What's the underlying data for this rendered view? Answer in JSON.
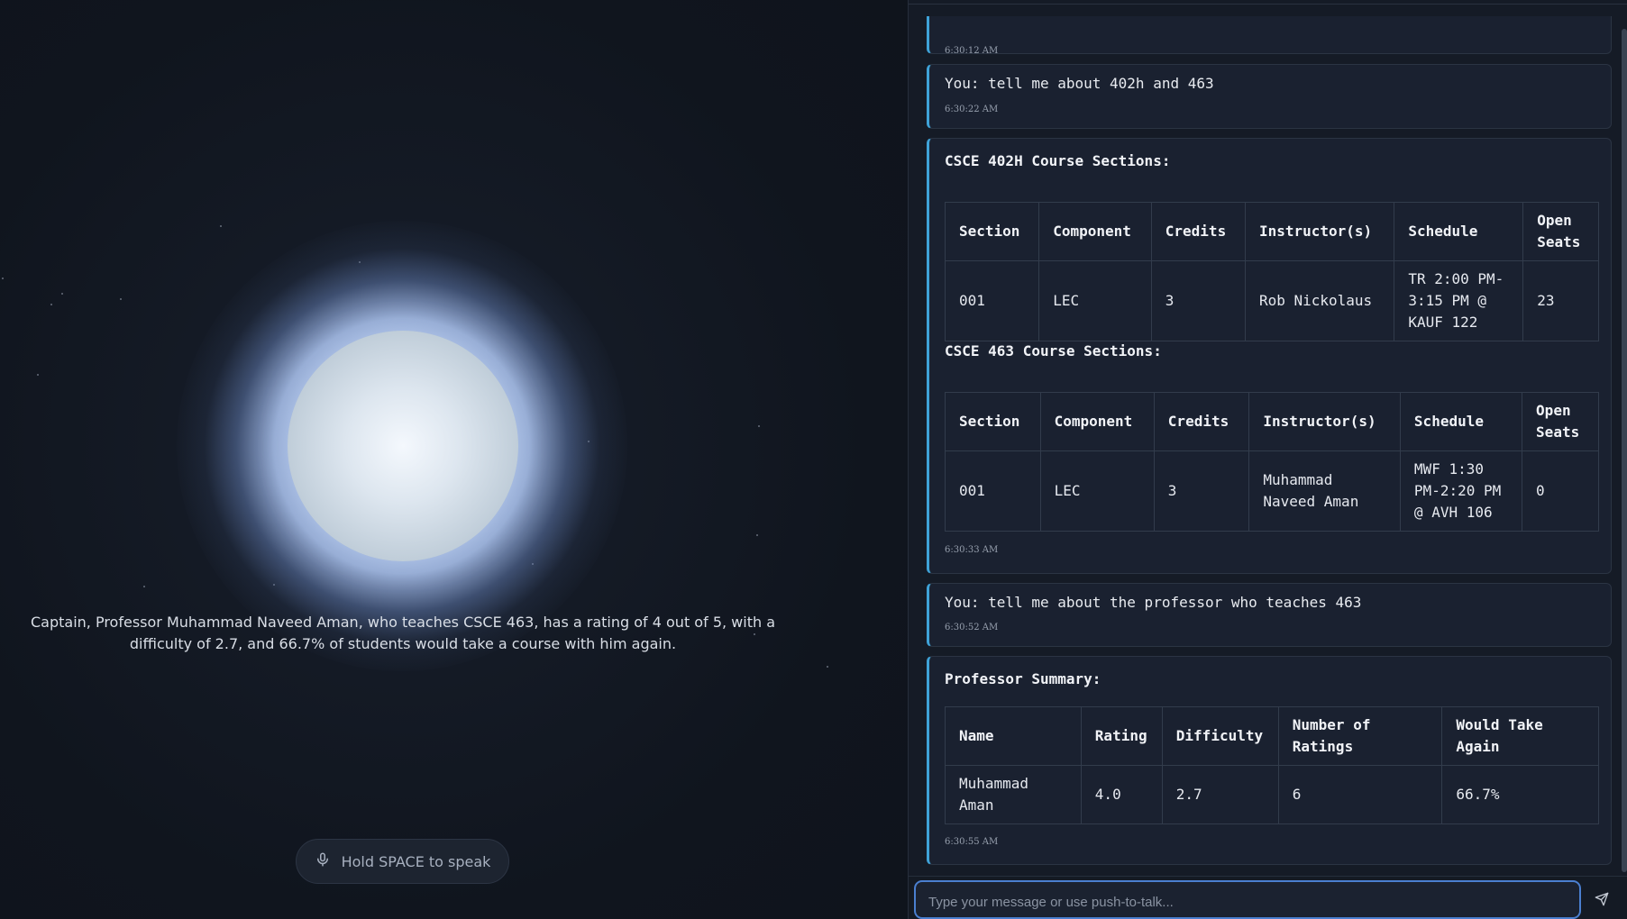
{
  "assistant": {
    "caption": "Captain, Professor Muhammad Naveed Aman, who teaches CSCE 463, has a rating of 4 out of 5, with a difficulty of 2.7, and 66.7% of students would take a course with him again.",
    "push_to_talk_label": "Hold SPACE to speak",
    "mic_icon": "microphone-icon"
  },
  "chat": {
    "messages": [
      {
        "type": "partial",
        "timestamp": "6:30:12 AM"
      },
      {
        "type": "user",
        "text": "You: tell me about 402h and 463",
        "timestamp": "6:30:22 AM"
      },
      {
        "type": "assistant",
        "timestamp": "6:30:33 AM",
        "sections": [
          {
            "heading": "CSCE 402H Course Sections:",
            "columns": [
              "Section",
              "Component",
              "Credits",
              "Instructor(s)",
              "Schedule",
              "Open Seats"
            ],
            "rows": [
              [
                "001",
                "LEC",
                "3",
                "Rob Nickolaus",
                "TR 2:00 PM-3:15 PM @ KAUF 122",
                "23"
              ]
            ]
          },
          {
            "heading": "CSCE 463 Course Sections:",
            "columns": [
              "Section",
              "Component",
              "Credits",
              "Instructor(s)",
              "Schedule",
              "Open Seats"
            ],
            "rows": [
              [
                "001",
                "LEC",
                "3",
                "Muhammad Naveed Aman",
                "MWF 1:30 PM-2:20 PM @ AVH 106",
                "0"
              ]
            ]
          }
        ]
      },
      {
        "type": "user",
        "text": "You: tell me about the professor who teaches 463",
        "timestamp": "6:30:52 AM"
      },
      {
        "type": "assistant",
        "timestamp": "6:30:55 AM",
        "sections": [
          {
            "heading": "Professor Summary:",
            "columns": [
              "Name",
              "Rating",
              "Difficulty",
              "Number of Ratings",
              "Would Take Again"
            ],
            "rows": [
              [
                "Muhammad Aman",
                "4.0",
                "2.7",
                "6",
                "66.7%"
              ]
            ]
          }
        ]
      }
    ]
  },
  "input": {
    "placeholder": "Type your message or use push-to-talk...",
    "value": "",
    "send_icon": "send-icon"
  },
  "colors": {
    "accent": "#3fa3d8",
    "input_border": "#4a7fd0",
    "background": "#0f141d"
  }
}
